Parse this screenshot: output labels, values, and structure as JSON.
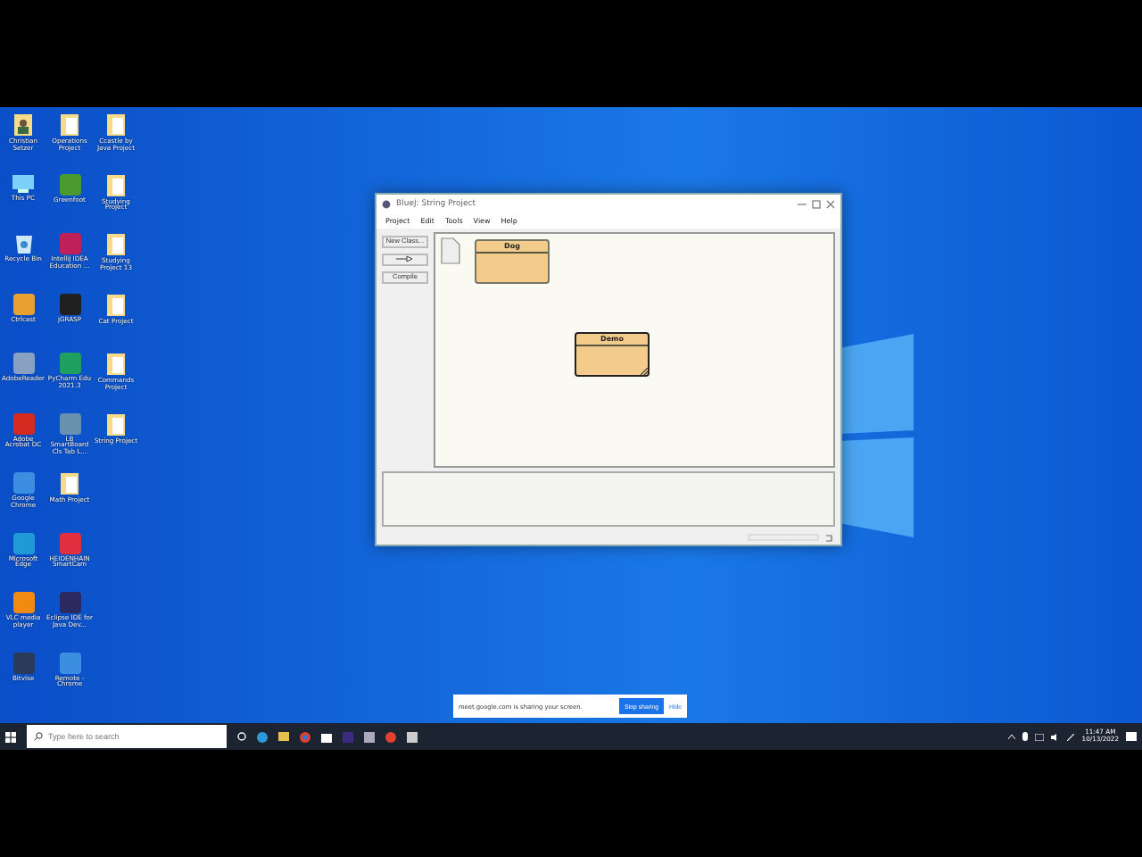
{
  "desktop_icons": [
    {
      "label": "Christian Setzer",
      "kind": "user"
    },
    {
      "label": "This PC",
      "kind": "pc"
    },
    {
      "label": "Recycle Bin",
      "kind": "bin"
    },
    {
      "label": "Ctrlcast",
      "kind": "app",
      "color": "#e8a030"
    },
    {
      "label": "AdobeReader",
      "kind": "app",
      "color": "#8aa0c0"
    },
    {
      "label": "Adobe Acrobat DC",
      "kind": "app",
      "color": "#d42a20"
    },
    {
      "label": "Google Chrome",
      "kind": "app",
      "color": "#3b8ee0"
    },
    {
      "label": "Microsoft Edge",
      "kind": "app",
      "color": "#1f9ad6"
    },
    {
      "label": "VLC media player",
      "kind": "app",
      "color": "#f08a10"
    },
    {
      "label": "Bitvise",
      "kind": "app",
      "color": "#2a3a5a"
    },
    {
      "label": "Operations Project",
      "kind": "folder"
    },
    {
      "label": "Greenfoot",
      "kind": "app",
      "color": "#4a9a30"
    },
    {
      "label": "IntelliJ IDEA Education ...",
      "kind": "app",
      "color": "#c0205a"
    },
    {
      "label": "jGRASP",
      "kind": "app",
      "color": "#202020"
    },
    {
      "label": "PyCharm Edu 2021.3",
      "kind": "app",
      "color": "#20a060"
    },
    {
      "label": "LB SmartBoard Cls Tab L...",
      "kind": "app",
      "color": "#6a90b0"
    },
    {
      "label": "Math Project",
      "kind": "folder"
    },
    {
      "label": "HEIDENHAIN SmartCam",
      "kind": "app",
      "color": "#e03040"
    },
    {
      "label": "Eclipse IDE for Java Dev...",
      "kind": "app",
      "color": "#2a2a60"
    },
    {
      "label": "Remote - Chrome",
      "kind": "app",
      "color": "#3b8ee0"
    },
    {
      "label": "Ccastle by Java Project",
      "kind": "folder"
    },
    {
      "label": "Studying Project",
      "kind": "folder"
    },
    {
      "label": "Studying Project 13",
      "kind": "folder"
    },
    {
      "label": "Cat Project",
      "kind": "folder"
    },
    {
      "label": "Commands Project",
      "kind": "folder"
    },
    {
      "label": "String Project",
      "kind": "folder"
    }
  ],
  "window": {
    "title": "BlueJ: String Project",
    "menu": [
      "Project",
      "Edit",
      "Tools",
      "View",
      "Help"
    ],
    "buttons": [
      {
        "label": "New Class...",
        "kind": "text"
      },
      {
        "kind": "arrow"
      },
      {
        "label": "Compile",
        "kind": "text"
      }
    ],
    "classes": [
      {
        "name": "Dog",
        "selected": false
      },
      {
        "name": "Demo",
        "selected": true
      }
    ]
  },
  "share_bar": {
    "message": "meet.google.com is sharing your screen.",
    "stop": "Stop sharing",
    "hide": "Hide"
  },
  "taskbar": {
    "search_placeholder": "Type here to search",
    "time": "11:47 AM",
    "date": "10/13/2022"
  }
}
